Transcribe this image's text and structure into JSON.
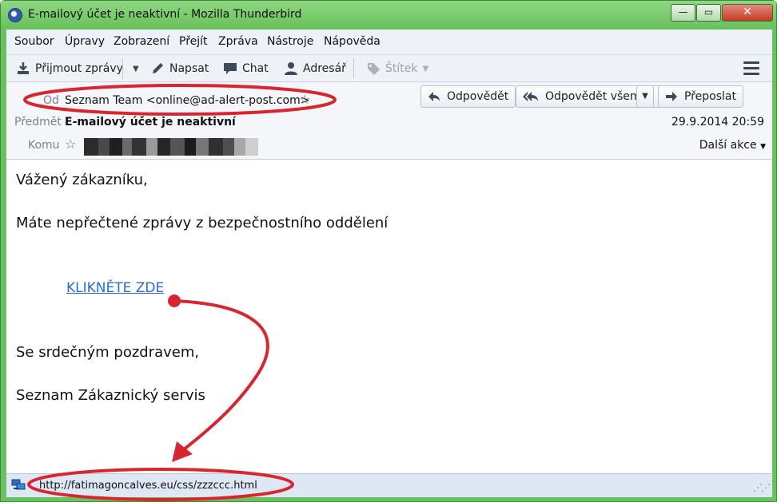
{
  "window": {
    "title": "E-mailový účet je neaktivní - Mozilla Thunderbird",
    "controls": {
      "minimize": "—",
      "maximize": "▭",
      "close": "✕"
    }
  },
  "menubar": {
    "items": [
      "Soubor",
      "Úpravy",
      "Zobrazení",
      "Přejít",
      "Zpráva",
      "Nástroje",
      "Nápověda"
    ]
  },
  "toolbar": {
    "get_messages": "Přijmout zprávy",
    "write": "Napsat",
    "chat": "Chat",
    "address_book": "Adresář",
    "tag": "Štítek"
  },
  "header": {
    "from_label": "Od",
    "from_value": "Seznam Team <online@ad-alert-post.com>",
    "subject_label": "Předmět",
    "subject_value": "E-mailový účet je neaktivní",
    "to_label": "Komu",
    "date": "29.9.2014 20:59",
    "more_actions": "Další akce",
    "reply": "Odpovědět",
    "reply_all": "Odpovědět všem",
    "forward": "Přeposlat"
  },
  "message": {
    "greeting": "Vážený zákazníku,",
    "line1": "Máte nepřečtené zprávy z bezpečnostního oddělení",
    "link_text": "KLIKNĚTE ZDE",
    "closing": "Se srdečným pozdravem,",
    "signature": "Seznam Zákaznický servis"
  },
  "statusbar": {
    "url": "http://fatimagoncalves.eu/css/zzzccc.html"
  },
  "colors": {
    "titlebar": "#69c15f",
    "annotation": "#d9262e",
    "link": "#2a6ccf"
  }
}
